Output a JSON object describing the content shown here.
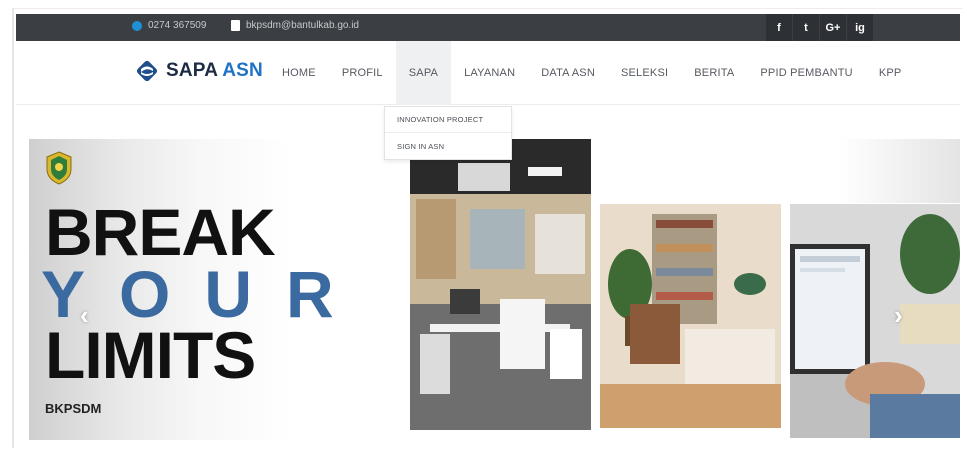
{
  "topbar": {
    "phone": "0274 367509",
    "email": "bkpsdm@bantulkab.go.id",
    "socials": [
      "f",
      "t",
      "G+",
      "ig"
    ]
  },
  "brand": {
    "name_part1": "SAPA",
    "name_part2": "ASN"
  },
  "menu": {
    "items": [
      "HOME",
      "PROFIL",
      "SAPA",
      "LAYANAN",
      "DATA ASN",
      "SELEKSI",
      "BERITA",
      "PPID PEMBANTU",
      "KPP"
    ],
    "active": "SAPA"
  },
  "dropdown": {
    "items": [
      "INNOVATION PROJECT",
      "SIGN IN ASN"
    ]
  },
  "hero": {
    "line1": "BREAK",
    "line2_letters": [
      "Y",
      "O",
      "U",
      "R"
    ],
    "line3": "LIMITS",
    "subtitle": "BKPSDM",
    "prev_arrow": "‹",
    "next_arrow": "›"
  },
  "colors": {
    "topbar": "#3b3f44",
    "brand_blue": "#1f73c4",
    "your_blue": "#3b6aa0"
  }
}
